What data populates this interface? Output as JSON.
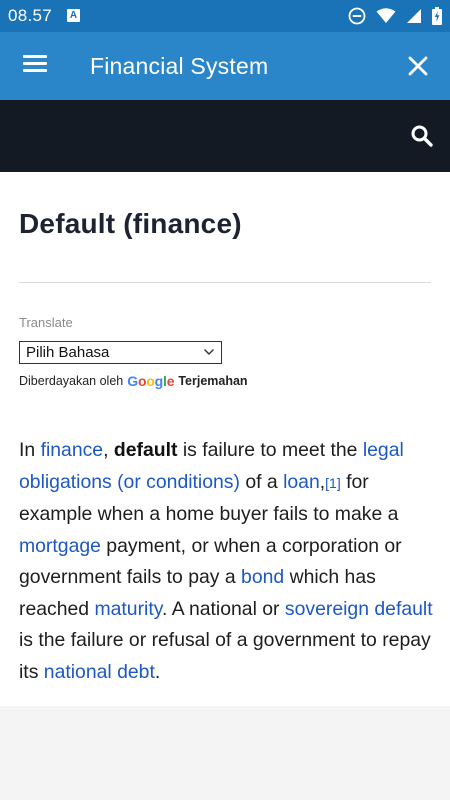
{
  "status_bar": {
    "time": "08.57",
    "notification_letter": "A"
  },
  "app_bar": {
    "title": "Financial System"
  },
  "article": {
    "title": "Default (finance)",
    "translate": {
      "label": "Translate",
      "selected_language": "Pilih Bahasa",
      "powered_by": "Diberdayakan oleh",
      "google_letters": [
        "G",
        "o",
        "o",
        "g",
        "l",
        "e"
      ],
      "service_link": "Terjemahan"
    },
    "paragraph": {
      "t1": "In ",
      "link_finance": "finance",
      "t2": ", ",
      "bold_default": "default",
      "t3": " is failure to meet the ",
      "link_legal": "legal obligations (or conditions)",
      "t4": " of a ",
      "link_loan": "loan",
      "t5": ",",
      "ref1": "[1]",
      "t6": " for example when a home buyer fails to make a ",
      "link_mortgage": "mortgage",
      "t7": " payment, or when a corporation or government fails to pay a ",
      "link_bond": "bond",
      "t8": " which has reached ",
      "link_maturity": "maturity",
      "t9": ". A national or ",
      "link_sovereign": "sovereign default",
      "t10": " is the failure or refusal of a government to repay its ",
      "link_national_debt": "national debt",
      "t11": "."
    }
  },
  "colors": {
    "status_bar": "#1a73b6",
    "app_bar": "#2a86c8",
    "dark_bar": "#141a24",
    "link": "#1d58c4"
  },
  "icons": {
    "menu": "hamburger-icon",
    "close": "close-icon",
    "search": "search-icon",
    "status": [
      "dnd-icon",
      "wifi-icon",
      "signal-icon",
      "battery-icon"
    ]
  }
}
